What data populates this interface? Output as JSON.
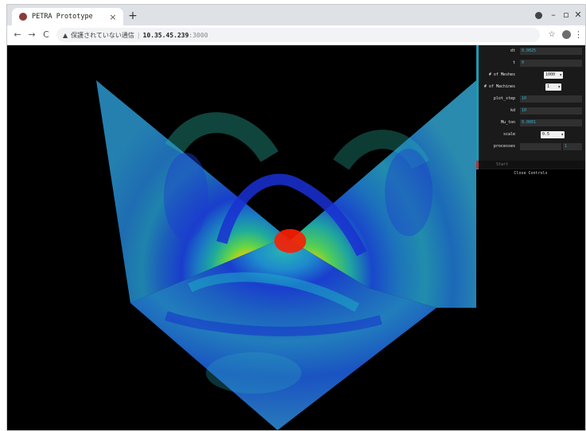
{
  "browser": {
    "tab_title": "PETRA Prototype",
    "tab_close": "×",
    "new_tab": "+",
    "window_controls": {
      "minimize": "–",
      "restore": "▫",
      "close": "✕"
    },
    "nav": {
      "back": "←",
      "forward": "→",
      "reload": "C"
    },
    "security_icon": "▲",
    "security_text": "保護されていない通信",
    "url_host": "10.35.45.239",
    "url_port": ":3000",
    "bookmark_icon": "☆",
    "menu_icon": "⋮"
  },
  "controls": {
    "rows": [
      {
        "label": "dt",
        "value": "0.0025",
        "kind": "text"
      },
      {
        "label": "t",
        "value": "0",
        "kind": "text"
      },
      {
        "label": "# of Meshes",
        "value": "1000",
        "kind": "select"
      },
      {
        "label": "# of Machines",
        "value": "1",
        "kind": "select"
      },
      {
        "label": "plot_step",
        "value": "10",
        "kind": "text"
      },
      {
        "label": "kd",
        "value": "10",
        "kind": "text"
      },
      {
        "label": "Mu_ton",
        "value": "0.0001",
        "kind": "text"
      },
      {
        "label": "scale",
        "value": "0.5",
        "kind": "select"
      },
      {
        "label": "processes",
        "value": "1",
        "kind": "slider"
      }
    ],
    "start_label": "Start",
    "close_label": "Close Controls"
  },
  "colors": {
    "accent": "#1d9bb5",
    "start_bar": "#b8323c",
    "panel_bg": "#1a1a1a",
    "field_value": "#2ab2d3"
  }
}
